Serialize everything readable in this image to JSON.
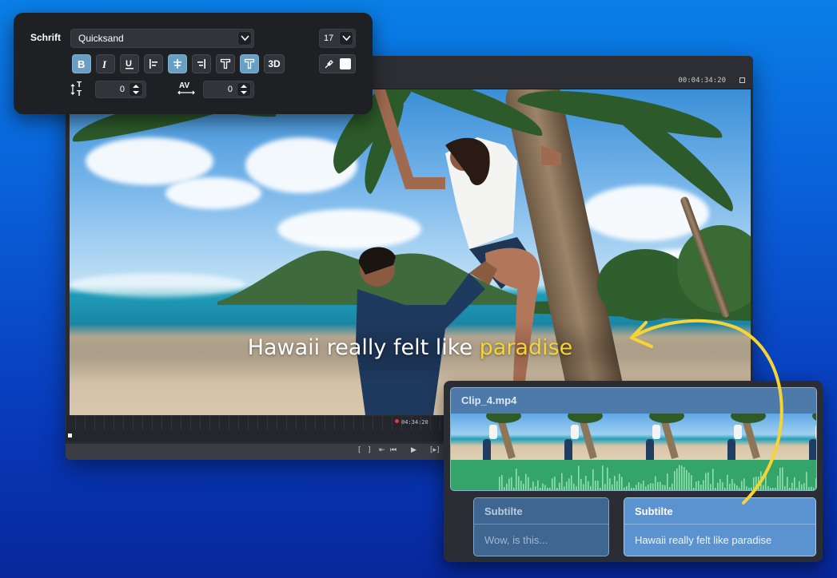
{
  "font_panel": {
    "label": "Schrift",
    "font_name": "Quicksand",
    "font_size": "17",
    "tracking_value": "0",
    "kerning_value": "0",
    "three_d_label": "3D",
    "text_color": "#ffffff"
  },
  "editor": {
    "timecode_top": "00:04:34:20",
    "playhead_time": "04:34:20",
    "caption_main": "Hawaii really felt like ",
    "caption_highlight": "paradise",
    "caption_highlight_color": "#f5d433"
  },
  "timeline": {
    "clip_name": "Clip_4.mp4",
    "subtitles": [
      {
        "title": "Subtilte",
        "text": "Wow, is this..."
      },
      {
        "title": "Subtilte",
        "text": "Hawaii really felt like paradise"
      }
    ]
  },
  "colors": {
    "accent_blue": "#5a93cf",
    "active_button": "#6a9fc4",
    "highlight_yellow": "#f5d433",
    "audio_green": "#35a46a"
  }
}
